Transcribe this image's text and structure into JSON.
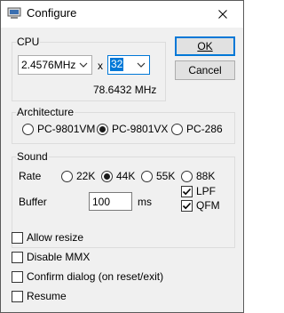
{
  "window": {
    "title": "Configure"
  },
  "buttons": {
    "ok": "OK",
    "cancel": "Cancel"
  },
  "cpu": {
    "legend": "CPU",
    "clock_select": "2.4576MHz",
    "multiply_sign": "x",
    "multiplier_select": "32",
    "result": "78.6432 MHz"
  },
  "architecture": {
    "legend": "Architecture",
    "options": [
      {
        "label": "PC-9801VM",
        "selected": false
      },
      {
        "label": "PC-9801VX",
        "selected": true
      },
      {
        "label": "PC-286",
        "selected": false
      }
    ]
  },
  "sound": {
    "legend": "Sound",
    "rate_label": "Rate",
    "rates": [
      {
        "label": "22K",
        "selected": false
      },
      {
        "label": "44K",
        "selected": true
      },
      {
        "label": "55K",
        "selected": false
      },
      {
        "label": "88K",
        "selected": false
      }
    ],
    "buffer_label": "Buffer",
    "buffer_value": "100",
    "buffer_unit": "ms",
    "lpf": {
      "label": "LPF",
      "checked": true
    },
    "qfm": {
      "label": "QFM",
      "checked": true
    }
  },
  "options": [
    {
      "label": "Allow resize",
      "checked": false
    },
    {
      "label": "Disable MMX",
      "checked": false
    },
    {
      "label": "Confirm dialog (on reset/exit)",
      "checked": false
    },
    {
      "label": "Resume",
      "checked": false
    }
  ],
  "colors": {
    "accent": "#0078d7",
    "dialog_bg": "#f0f0f0",
    "title_bg": "#ffffff"
  }
}
